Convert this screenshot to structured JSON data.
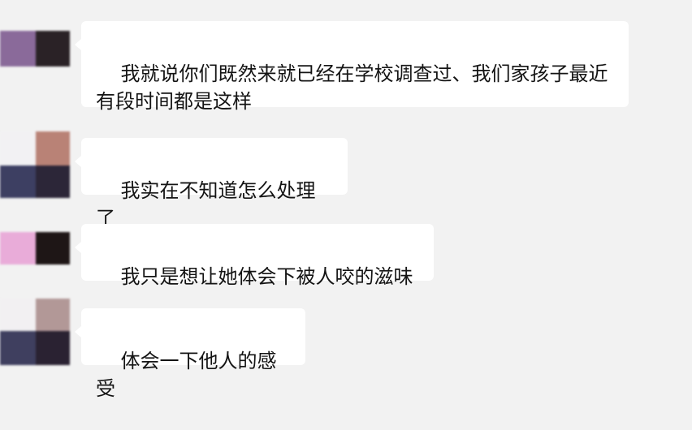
{
  "chat": {
    "messages": [
      {
        "text": "我就说你们既然来就已经在学校调查过、我们家孩子最近有段时间都是这样",
        "avatar": {
          "icon": "pixelated-avatar-icon",
          "colors": [
            "#8a6a9a",
            "#2a2226",
            "#cfc8cf",
            "#f4f4f4"
          ]
        }
      },
      {
        "text": "我实在不知道怎么处理了",
        "avatar": {
          "icon": "pixelated-avatar-icon",
          "colors": [
            "#f2f1f3",
            "#b98276",
            "#3d3f62",
            "#2c2638"
          ]
        }
      },
      {
        "text": "我只是想让她体会下被人咬的滋味",
        "avatar": {
          "icon": "pixelated-avatar-icon",
          "colors": [
            "#e9acd9",
            "#1e1616",
            "#f2f2f2",
            "#f2f2f2"
          ]
        }
      },
      {
        "text": "体会一下他人的感受",
        "avatar": {
          "icon": "pixelated-avatar-icon",
          "colors": [
            "#f2f0f2",
            "#b29897",
            "#3f3f5f",
            "#2a2232"
          ]
        }
      }
    ]
  }
}
